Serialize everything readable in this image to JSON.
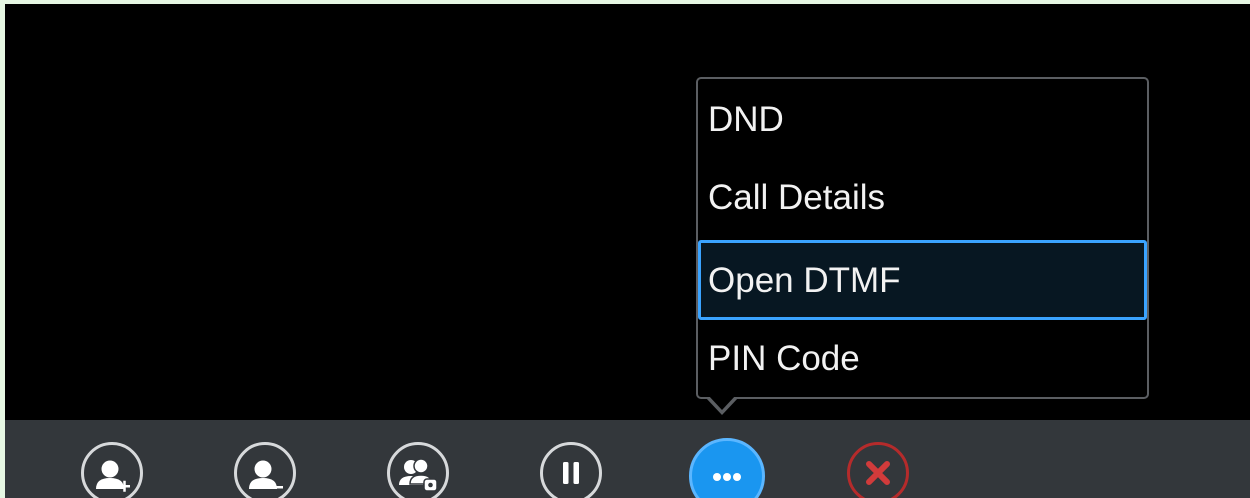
{
  "menu": {
    "items": [
      {
        "label": "DND"
      },
      {
        "label": "Call Details"
      },
      {
        "label": "Open DTMF",
        "selected": true
      },
      {
        "label": "PIN Code"
      }
    ]
  },
  "toolbar": {
    "buttons": [
      {
        "icon": "add-participant-icon"
      },
      {
        "icon": "remove-participant-icon"
      },
      {
        "icon": "conference-manage-icon"
      },
      {
        "icon": "hold-icon"
      },
      {
        "icon": "more-icon",
        "active": true
      },
      {
        "icon": "end-call-icon"
      }
    ]
  },
  "colors": {
    "background": "#000000",
    "toolbar": "#33373b",
    "menu_border": "#5b5e62",
    "selection_border": "#3aa3ff",
    "active_button": "#1a96f0",
    "end_call": "#d13b3b"
  }
}
